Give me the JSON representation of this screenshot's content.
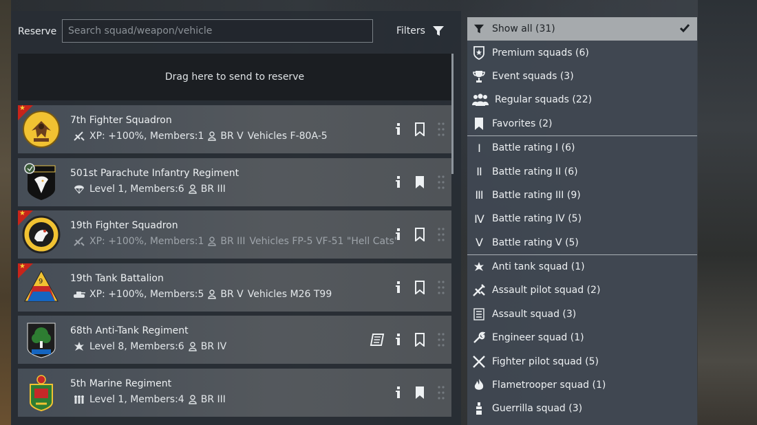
{
  "reserve": {
    "label": "Reserve",
    "search_placeholder": "Search squad/weapon/vehicle",
    "search_value": "",
    "filters_label": "Filters",
    "drop_zone_text": "Drag here to send to reserve"
  },
  "squads": [
    {
      "name": "7th Fighter Squadron",
      "info": "XP: +100%, Members:1",
      "br": "BR V",
      "vehicles": "Vehicles F-80A-5",
      "premium": true,
      "bookmarked": false,
      "type_icon": "fighter-pilot-icon"
    },
    {
      "name": "501st Parachute Infantry Regiment",
      "info": "Level 1, Members:6",
      "br": "BR III",
      "vehicles": "",
      "premium": false,
      "bookmarked": true,
      "type_icon": "paratrooper-icon"
    },
    {
      "name": "19th Fighter Squadron",
      "info": "XP: +100%, Members:1",
      "br": "BR III",
      "vehicles": "Vehicles FP-5 VF-51 \"Hell Cats\"",
      "premium": true,
      "bookmarked": false,
      "type_icon": "fighter-pilot-icon"
    },
    {
      "name": "19th Tank Battalion",
      "info": "XP: +100%, Members:5",
      "br": "BR V",
      "vehicles": "Vehicles M26 T99",
      "premium": true,
      "bookmarked": false,
      "type_icon": "tank-icon"
    },
    {
      "name": "68th Anti-Tank Regiment",
      "info": "Level 8, Members:6",
      "br": "BR IV",
      "vehicles": "",
      "premium": false,
      "bookmarked": false,
      "type_icon": "anti-tank-icon"
    },
    {
      "name": "5th Marine Regiment",
      "info": "Level 1, Members:4",
      "br": "BR III",
      "vehicles": "",
      "premium": false,
      "bookmarked": true,
      "type_icon": "infantry-icon"
    }
  ],
  "filters": {
    "show_all": "Show all (31)",
    "premium": "Premium squads (6)",
    "event": "Event squads (3)",
    "regular": "Regular squads (22)",
    "favorites": "Favorites (2)",
    "br1_numeral": "I",
    "br1": "Battle rating I (6)",
    "br2_numeral": "II",
    "br2": "Battle rating II (6)",
    "br3_numeral": "III",
    "br3": "Battle rating III (9)",
    "br4_numeral": "IV",
    "br4": "Battle rating IV (5)",
    "br5_numeral": "V",
    "br5": "Battle rating V (5)",
    "anti_tank": "Anti tank squad (1)",
    "assault_pilot": "Assault pilot squad (2)",
    "assault": "Assault squad (3)",
    "engineer": "Engineer squad (1)",
    "fighter_pilot": "Fighter pilot squad (5)",
    "flametrooper": "Flametrooper squad (1)",
    "guerrilla": "Guerrilla squad (3)"
  }
}
